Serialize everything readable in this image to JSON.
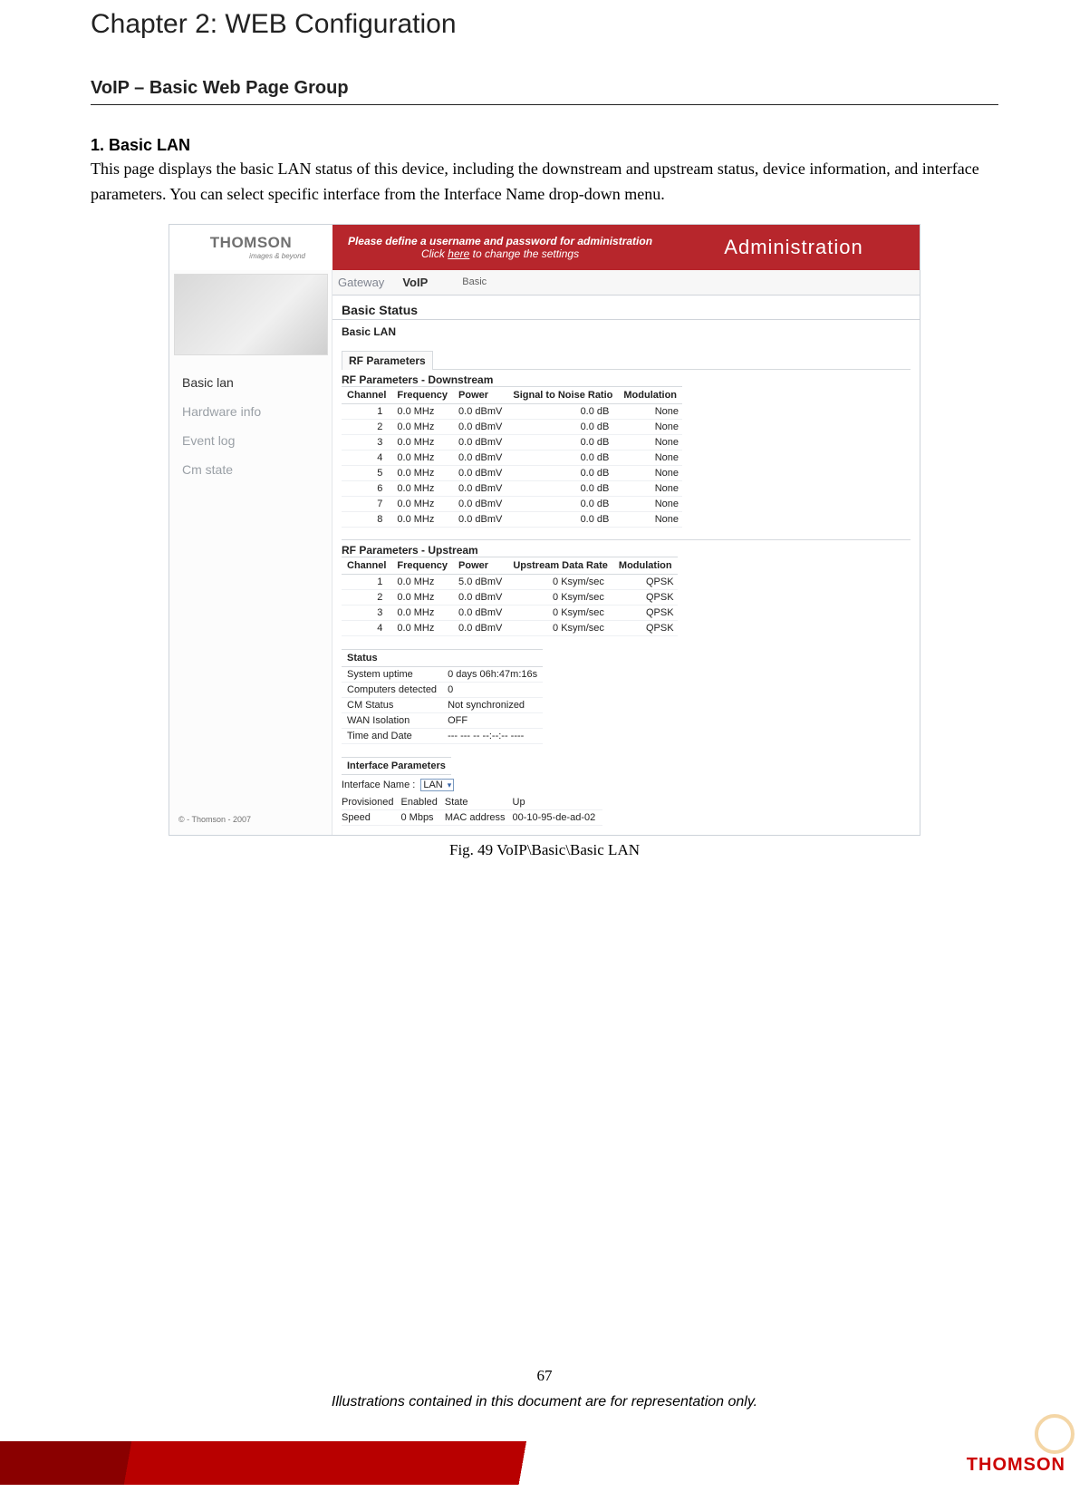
{
  "chapter_title": "Chapter 2: WEB Configuration",
  "section_title": "VoIP – Basic Web Page Group",
  "sub_title": "1. Basic LAN",
  "body_text": "This page displays the basic LAN status of this device, including the downstream and upstream status, device information, and interface parameters. You can select specific interface from the Interface Name drop-down menu.",
  "fig_caption": "Fig. 49 VoIP\\Basic\\Basic LAN",
  "page_num": "67",
  "disclaimer": "Illustrations contained in this document are for representation only.",
  "footer_logo": "THOMSON",
  "shot": {
    "logo_word": "THOMSON",
    "logo_sub": "images & beyond",
    "banner_line1_pre": "Please define a username and password for administration",
    "banner_line2_pre": "Click ",
    "banner_here": "here",
    "banner_line2_post": " to change the settings",
    "banner_right": "Administration",
    "tabs": {
      "t1": "Gateway",
      "t2": "VoIP",
      "sub": "Basic"
    },
    "head1": "Basic Status",
    "head2": "Basic LAN",
    "nav": {
      "i1": "Basic lan",
      "i2": "Hardware info",
      "i3": "Event log",
      "i4": "Cm state"
    },
    "copyright": "© - Thomson - 2007",
    "rf_title": "RF Parameters",
    "rf_down_title": "RF Parameters - Downstream",
    "rf_down_headers": {
      "c1": "Channel",
      "c2": "Frequency",
      "c3": "Power",
      "c4": "Signal to Noise Ratio",
      "c5": "Modulation"
    },
    "rf_down_rows": [
      {
        "ch": "1",
        "freq": "0.0 MHz",
        "pow": "0.0 dBmV",
        "snr": "0.0 dB",
        "mod": "None"
      },
      {
        "ch": "2",
        "freq": "0.0 MHz",
        "pow": "0.0 dBmV",
        "snr": "0.0 dB",
        "mod": "None"
      },
      {
        "ch": "3",
        "freq": "0.0 MHz",
        "pow": "0.0 dBmV",
        "snr": "0.0 dB",
        "mod": "None"
      },
      {
        "ch": "4",
        "freq": "0.0 MHz",
        "pow": "0.0 dBmV",
        "snr": "0.0 dB",
        "mod": "None"
      },
      {
        "ch": "5",
        "freq": "0.0 MHz",
        "pow": "0.0 dBmV",
        "snr": "0.0 dB",
        "mod": "None"
      },
      {
        "ch": "6",
        "freq": "0.0 MHz",
        "pow": "0.0 dBmV",
        "snr": "0.0 dB",
        "mod": "None"
      },
      {
        "ch": "7",
        "freq": "0.0 MHz",
        "pow": "0.0 dBmV",
        "snr": "0.0 dB",
        "mod": "None"
      },
      {
        "ch": "8",
        "freq": "0.0 MHz",
        "pow": "0.0 dBmV",
        "snr": "0.0 dB",
        "mod": "None"
      }
    ],
    "rf_up_title": "RF Parameters - Upstream",
    "rf_up_headers": {
      "c1": "Channel",
      "c2": "Frequency",
      "c3": "Power",
      "c4": "Upstream Data Rate",
      "c5": "Modulation"
    },
    "rf_up_rows": [
      {
        "ch": "1",
        "freq": "0.0 MHz",
        "pow": "5.0 dBmV",
        "rate": "0 Ksym/sec",
        "mod": "QPSK"
      },
      {
        "ch": "2",
        "freq": "0.0 MHz",
        "pow": "0.0 dBmV",
        "rate": "0 Ksym/sec",
        "mod": "QPSK"
      },
      {
        "ch": "3",
        "freq": "0.0 MHz",
        "pow": "0.0 dBmV",
        "rate": "0 Ksym/sec",
        "mod": "QPSK"
      },
      {
        "ch": "4",
        "freq": "0.0 MHz",
        "pow": "0.0 dBmV",
        "rate": "0 Ksym/sec",
        "mod": "QPSK"
      }
    ],
    "status_title": "Status",
    "status_rows": [
      {
        "k": "System uptime",
        "v": "0 days 06h:47m:16s"
      },
      {
        "k": "Computers detected",
        "v": "0"
      },
      {
        "k": "CM Status",
        "v": "Not synchronized"
      },
      {
        "k": "WAN Isolation",
        "v": "OFF"
      },
      {
        "k": "Time and Date",
        "v": "--- --- -- --:--:-- ----"
      }
    ],
    "iface_title": "Interface Parameters",
    "iface_name_label": "Interface Name :",
    "iface_name_value": "LAN",
    "iface_grid": {
      "provisioned_k": "Provisioned",
      "provisioned_v": "Enabled",
      "state_k": "State",
      "state_v": "Up",
      "speed_k": "Speed",
      "speed_v": "0 Mbps",
      "mac_k": "MAC address",
      "mac_v": "00-10-95-de-ad-02"
    }
  }
}
